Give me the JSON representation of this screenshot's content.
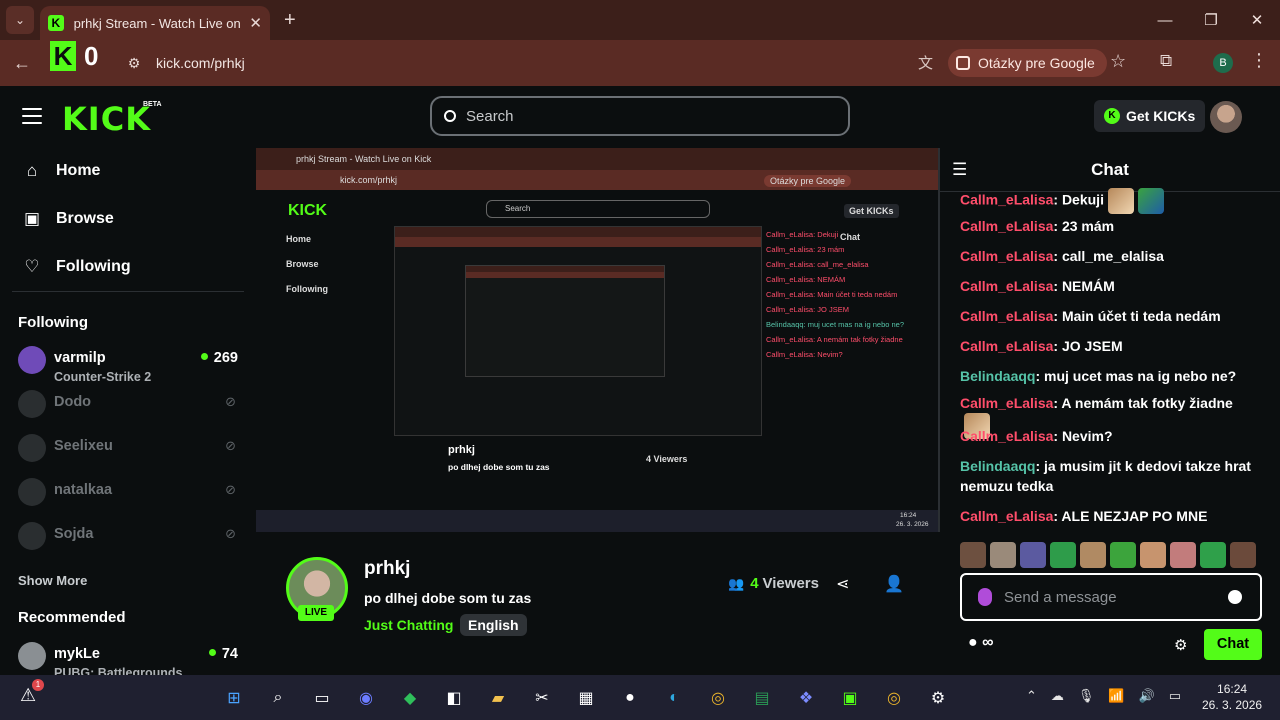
{
  "browser": {
    "tab_title": "prhkj Stream - Watch Live on Kick",
    "url": "kick.com/prhkj",
    "kick_counter": "0",
    "google_questions": "Otázky pre Google",
    "profile_initial": "B"
  },
  "header": {
    "logo": "KICK",
    "beta": "BETA",
    "search_placeholder": "Search",
    "get_kicks": "Get KICKs"
  },
  "sidebar": {
    "nav": [
      {
        "label": "Home",
        "icon": "home-icon"
      },
      {
        "label": "Browse",
        "icon": "browse-icon"
      },
      {
        "label": "Following",
        "icon": "heart-icon"
      }
    ],
    "following_heading": "Following",
    "following": [
      {
        "name": "varmilp",
        "sub": "Counter-Strike 2",
        "count": "269",
        "live": true
      },
      {
        "name": "Dodo",
        "live": false
      },
      {
        "name": "Seelixeu",
        "live": false
      },
      {
        "name": "natalkaa",
        "live": false
      },
      {
        "name": "Sojda",
        "live": false
      }
    ],
    "show_more": "Show More",
    "recommended_heading": "Recommended",
    "recommended": [
      {
        "name": "mykLe",
        "sub": "PUBG: Battlegrounds",
        "count": "74"
      }
    ]
  },
  "stream": {
    "streamer": "prhkj",
    "title": "po dlhej dobe som tu zas",
    "category": "Just Chatting",
    "tag": "English",
    "live": "LIVE",
    "viewers": "4",
    "viewers_label": "Viewers"
  },
  "player_preview": {
    "url": "kick.com/prhkj",
    "search": "Search",
    "get_kicks": "Get KICKs",
    "chat": "Chat",
    "home": "Home",
    "browse": "Browse",
    "following": "Following",
    "streamer": "prhkj",
    "title": "po dlhej dobe som tu zas",
    "viewers": "4 Viewers",
    "time": "16:24",
    "date": "26. 3. 2026"
  },
  "chat": {
    "title": "Chat",
    "messages": [
      {
        "user": "Callm_eLalisa",
        "text": ": Dekuji",
        "emote": true,
        "frog": true
      },
      {
        "user": "Callm_eLalisa",
        "text": ": 23 mám"
      },
      {
        "user": "Callm_eLalisa",
        "text": ": call_me_elalisa"
      },
      {
        "user": "Callm_eLalisa",
        "text": ": NEMÁM"
      },
      {
        "user": "Callm_eLalisa",
        "text": ": Main účet ti teda nedám"
      },
      {
        "user": "Callm_eLalisa",
        "text": ": JO JSEM"
      },
      {
        "user": "Belindaaqq",
        "text": ": muj ucet mas na ig nebo ne?"
      },
      {
        "user": "Callm_eLalisa",
        "text": ": A nemám tak fotky žiadne",
        "emote": true
      },
      {
        "user": "Callm_eLalisa",
        "text": ": Nevim?"
      },
      {
        "user": "Belindaaqq",
        "text": ": ja musim jit k dedovi takze hrat nemuzu tedka"
      },
      {
        "user": "Callm_eLalisa",
        "text": ": ALE NEZJAP PO MNE"
      }
    ],
    "input_placeholder": "Send a message",
    "points": "∞",
    "send_label": "Chat"
  },
  "taskbar": {
    "time": "16:24",
    "date": "26. 3. 2026",
    "notif": "1"
  },
  "colors": {
    "accent": "#53fc18",
    "chat_user_red": "#ff4e6b",
    "chat_user_teal": "#56c3a8",
    "chrome_tab": "#3c1f1a",
    "chrome_bar": "#5a2b24",
    "page_bg": "#0b0e0f"
  }
}
